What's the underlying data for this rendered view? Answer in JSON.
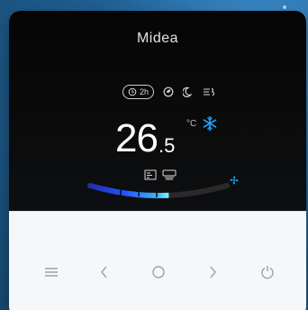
{
  "brand": "Midea",
  "status": {
    "timer_label": "2h",
    "icons": [
      "timer-icon",
      "eco-icon",
      "sleep-icon",
      "swing-icon"
    ]
  },
  "temperature": {
    "integer": "26",
    "decimal": ".5",
    "unit": "°C"
  },
  "mode": "cool",
  "fan_level": 0.55,
  "buttons": [
    "menu-button",
    "left-button",
    "ok-button",
    "right-button",
    "power-button"
  ],
  "colors": {
    "accent": "#1ea7ff",
    "screen": "#050505",
    "panel": "#f6f7f9"
  }
}
